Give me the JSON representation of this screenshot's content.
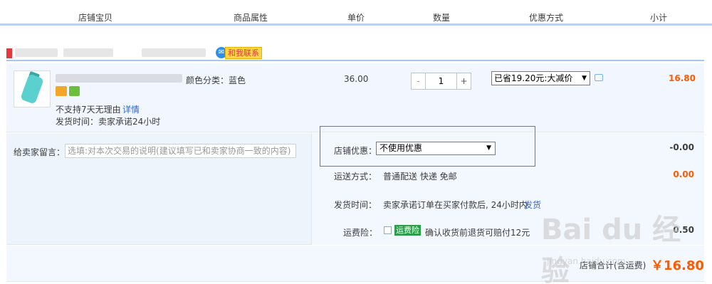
{
  "header": {
    "col_shop_item": "店铺宝贝",
    "col_attr": "商品属性",
    "col_price": "单价",
    "col_qty": "数量",
    "col_discount": "优惠方式",
    "col_subtotal": "小计"
  },
  "shop": {
    "contact_label": "和我联系"
  },
  "item": {
    "attr": "颜色分类：蓝色",
    "no_return": "不支持7天无理由",
    "detail_link": "详情",
    "ship_time": "发货时间：卖家承诺24小时",
    "price": "36.00",
    "qty_minus": "-",
    "qty_plus": "+",
    "qty": "1",
    "promo_selected": "已省19.20元:大减价",
    "subtotal": "16.80"
  },
  "order": {
    "message_label": "给卖家留言：",
    "message_placeholder": "选填:对本次交易的说明(建议填写已和卖家协商一致的内容)",
    "shop_discount_label": "店铺优惠：",
    "shop_discount_selected": "不使用优惠",
    "shop_discount_value": "-0.00",
    "shipping_label": "运送方式：",
    "shipping_value": "普通配送 快递 免邮",
    "shipping_fee": "0.00",
    "delivery_label": "发货时间：",
    "delivery_text": "卖家承诺订单在买家付款后, 24小时内",
    "delivery_link": "发货",
    "insurance_label": "运费险：",
    "insurance_badge": "运费险",
    "insurance_text": "确认收货前退货可赔付12元",
    "insurance_fee": "0.50",
    "total_label": "店铺合计(含运费)",
    "total_value": "￥16.80"
  },
  "watermark": {
    "brand": "Bai du 经验",
    "url": "jingyan.baidu.com"
  },
  "colors": {
    "accent_orange": "#ff5a00",
    "header_line": "#b2d1ff",
    "link_blue": "#3366cc",
    "highlight_red": "#e04a4a"
  }
}
